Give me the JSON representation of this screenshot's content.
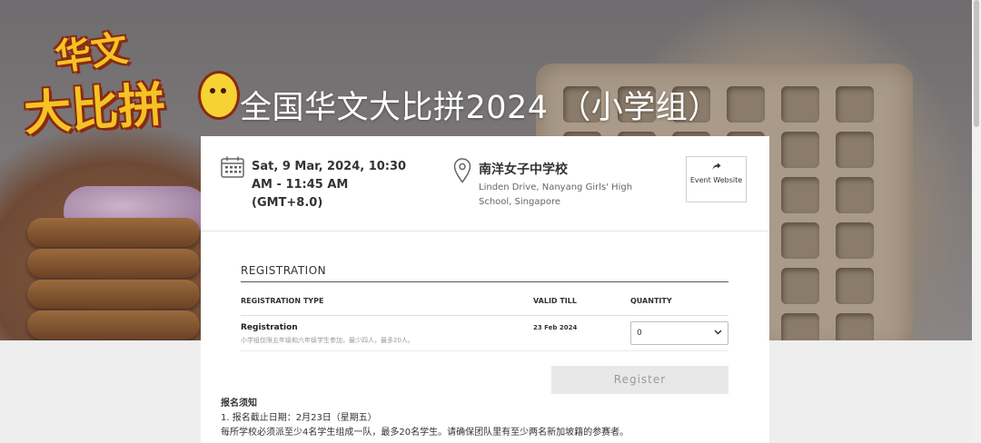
{
  "hero": {
    "logo_line1": "华文",
    "logo_line2": "大比拼",
    "title": "全国华文大比拼2024 （小学组）"
  },
  "event": {
    "date_time": "Sat, 9 Mar, 2024, 10:30 AM - 11:45 AM (GMT+8.0)",
    "venue_name": "南洋女子中学校",
    "venue_address": "Linden Drive, Nanyang Girls' High School, Singapore",
    "website_button": {
      "icon": "share-arrow-icon",
      "label": "Event Website"
    }
  },
  "registration": {
    "section_title": "REGISTRATION",
    "columns": {
      "type": "REGISTRATION TYPE",
      "valid_till": "VALID TILL",
      "quantity": "QUANTITY"
    },
    "rows": [
      {
        "type": "Registration",
        "description": "小学组仅限五年级和六年级学生参加，最少四人，最多20人。",
        "valid_till": "23 Feb 2024",
        "quantity": "0"
      }
    ],
    "register_label": "Register"
  },
  "notice": {
    "title": "报名须知",
    "line1": "1. 报名截止日期：2月23日（星期五）",
    "line2": "每所学校必须派至少4名学生组成一队，最多20名学生。请确保团队里有至少两名新加坡籍的参赛者。"
  },
  "colors": {
    "title_text": "#ffffff",
    "button_disabled_bg": "#e8e8e8",
    "button_disabled_text": "#9a9a9a",
    "logo_yellow": "#f5c324",
    "logo_outline": "#8a2a12"
  }
}
